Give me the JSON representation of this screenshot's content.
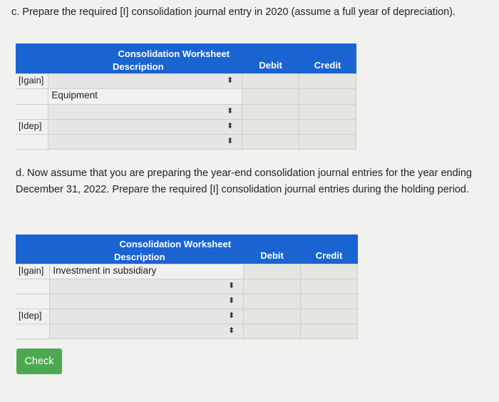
{
  "part_c": {
    "question": "c. Prepare the required [I] consolidation journal entry in 2020 (assume a full year of depreciation).",
    "table": {
      "title": "Consolidation Worksheet",
      "description_header": "Description",
      "debit_header": "Debit",
      "credit_header": "Credit",
      "rows": [
        {
          "label": "[Igain]",
          "account": ""
        },
        {
          "label": "",
          "account": "Equipment"
        },
        {
          "label": "",
          "account": ""
        },
        {
          "label": "[Idep]",
          "account": ""
        },
        {
          "label": "",
          "account": ""
        }
      ]
    }
  },
  "part_d": {
    "question": "d. Now assume that you are preparing the year-end consolidation journal entries for the year ending December 31, 2022. Prepare the required [I] consolidation journal entries during the holding period.",
    "table": {
      "title": "Consolidation Worksheet",
      "description_header": "Description",
      "debit_header": "Debit",
      "credit_header": "Credit",
      "rows": [
        {
          "label": "[Igain]",
          "account": "Investment in subsidiary"
        },
        {
          "label": "",
          "account": ""
        },
        {
          "label": "",
          "account": ""
        },
        {
          "label": "[Idep]",
          "account": ""
        },
        {
          "label": "",
          "account": ""
        }
      ]
    }
  },
  "check_button": "Check"
}
